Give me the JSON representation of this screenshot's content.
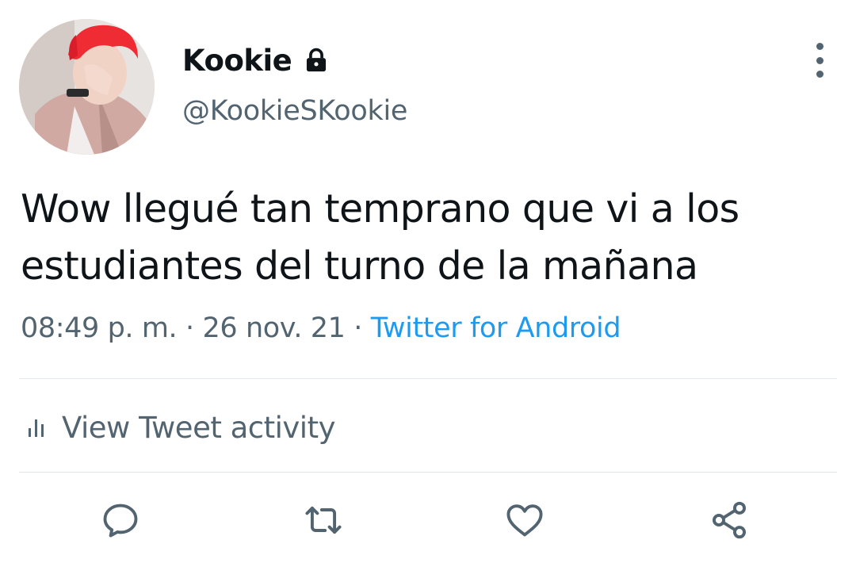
{
  "user": {
    "display_name": "Kookie",
    "handle": "@KookieSKookie",
    "protected_icon": "lock-icon",
    "avatar_icon": "avatar"
  },
  "tweet": {
    "text": "Wow llegué tan temprano que vi a los estudiantes del turno de la mañana",
    "time": "08:49 p. m.",
    "separator": "·",
    "date": "26 nov. 21",
    "source": "Twitter for Android"
  },
  "activity": {
    "label": "View Tweet activity",
    "icon": "bar-chart-icon"
  },
  "actions": [
    {
      "name": "reply",
      "icon": "reply-icon"
    },
    {
      "name": "retweet",
      "icon": "retweet-icon"
    },
    {
      "name": "like",
      "icon": "heart-icon"
    },
    {
      "name": "share",
      "icon": "share-icon"
    }
  ],
  "colors": {
    "text": "#0f1419",
    "secondary": "#536471",
    "link": "#1d9bf0",
    "divider": "#e1e6ea"
  }
}
